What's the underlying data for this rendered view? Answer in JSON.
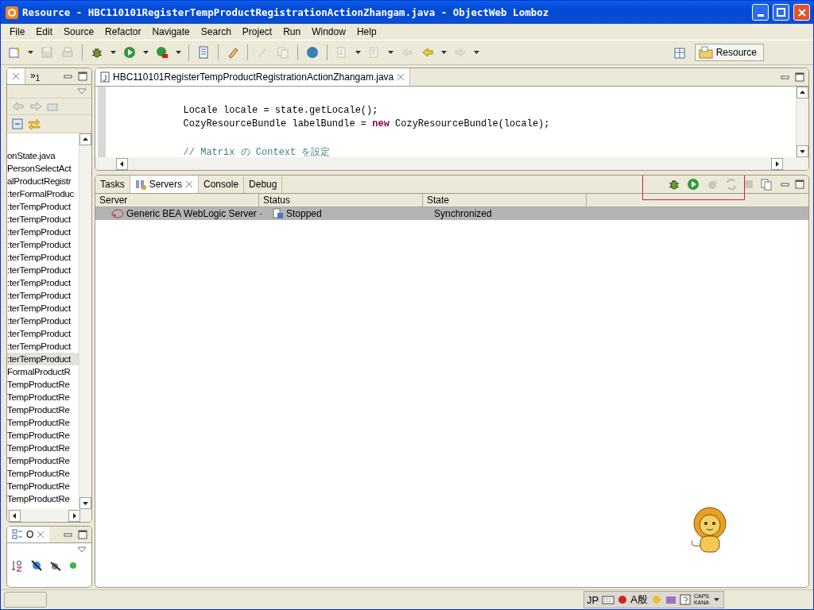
{
  "window": {
    "title": "Resource - HBC110101RegisterTempProductRegistrationActionZhangam.java - ObjectWeb Lomboz"
  },
  "menu": [
    "File",
    "Edit",
    "Source",
    "Refactor",
    "Navigate",
    "Search",
    "Project",
    "Run",
    "Window",
    "Help"
  ],
  "toolbar": [
    {
      "disabled": false
    },
    {
      "disabled": true
    },
    {
      "disabled": true
    },
    {
      "disabled": false
    },
    {
      "disabled": false
    },
    {
      "disabled": false
    },
    {
      "disabled": false
    },
    {
      "disabled": false
    },
    {
      "disabled": true
    },
    {
      "disabled": true
    },
    {
      "disabled": false
    },
    {
      "disabled": true
    },
    {
      "disabled": true
    },
    {
      "disabled": true
    },
    {
      "disabled": false
    },
    {
      "disabled": true
    }
  ],
  "perspective": {
    "label": "Resource"
  },
  "explorer": {
    "tab": "»$_{1}$",
    "files": [
      {
        "label": "onState.java",
        "selected": false
      },
      {
        "label": "PersonSelectAct",
        "selected": false
      },
      {
        "label": "alProductRegistr",
        "selected": false
      },
      {
        "label": ":terFormalProduc",
        "selected": false
      },
      {
        "label": ":terTempProduct",
        "selected": false
      },
      {
        "label": ":terTempProduct",
        "selected": false
      },
      {
        "label": ":terTempProduct",
        "selected": false
      },
      {
        "label": ":terTempProduct",
        "selected": false
      },
      {
        "label": ":terTempProduct",
        "selected": false
      },
      {
        "label": ":terTempProduct",
        "selected": false
      },
      {
        "label": ":terTempProduct",
        "selected": false
      },
      {
        "label": ":terTempProduct",
        "selected": false
      },
      {
        "label": ":terTempProduct",
        "selected": false
      },
      {
        "label": ":terTempProduct",
        "selected": false
      },
      {
        "label": ":terTempProduct",
        "selected": false
      },
      {
        "label": ":terTempProduct",
        "selected": false
      },
      {
        "label": ":terTempProduct",
        "selected": true
      },
      {
        "label": "FormalProductR",
        "selected": false
      },
      {
        "label": "TempProductRe",
        "selected": false
      },
      {
        "label": "TempProductRe",
        "selected": false
      },
      {
        "label": "TempProductRe",
        "selected": false
      },
      {
        "label": "TempProductRe",
        "selected": false
      },
      {
        "label": "TempProductRe",
        "selected": false
      },
      {
        "label": "TempProductRe",
        "selected": false
      },
      {
        "label": "TempProductRe",
        "selected": false
      },
      {
        "label": "TempProductRe",
        "selected": false
      },
      {
        "label": "TempProductRe",
        "selected": false
      },
      {
        "label": "TempProductRe",
        "selected": false
      }
    ]
  },
  "outline": {
    "tab": "O"
  },
  "editor": {
    "tab": "HBC110101RegisterTempProductRegistrationActionZhangam.java",
    "blocks": [
      [
        [
          {
            "kind": "plain",
            "text": "        Locale locale = state.getLocale();"
          }
        ],
        [
          {
            "kind": "plain",
            "text": "        CozyResourceBundle labelBundle = "
          },
          {
            "kind": "keyword",
            "text": "new"
          },
          {
            "kind": "plain",
            "text": " CozyResourceBundle(locale);"
          }
        ]
      ],
      [
        [
          {
            "kind": "comment",
            "text": "        // Matrix の Context を設定"
          }
        ]
      ]
    ]
  },
  "views": {
    "tabs": [
      {
        "label": "Tasks",
        "selected": false
      },
      {
        "label": "Servers",
        "selected": true
      },
      {
        "label": "Console",
        "selected": false
      },
      {
        "label": "Debug",
        "selected": false
      }
    ],
    "columns": [
      "Server",
      "Status",
      "State"
    ],
    "rows": [
      {
        "server": "Generic BEA WebLogic Server ·",
        "status": "Stopped",
        "state": "Synchronized",
        "selected": true
      }
    ]
  },
  "status_bar": {
    "ime": [
      "JP",
      "A般"
    ],
    "caps": "CAPS",
    "kana": "KANA"
  }
}
